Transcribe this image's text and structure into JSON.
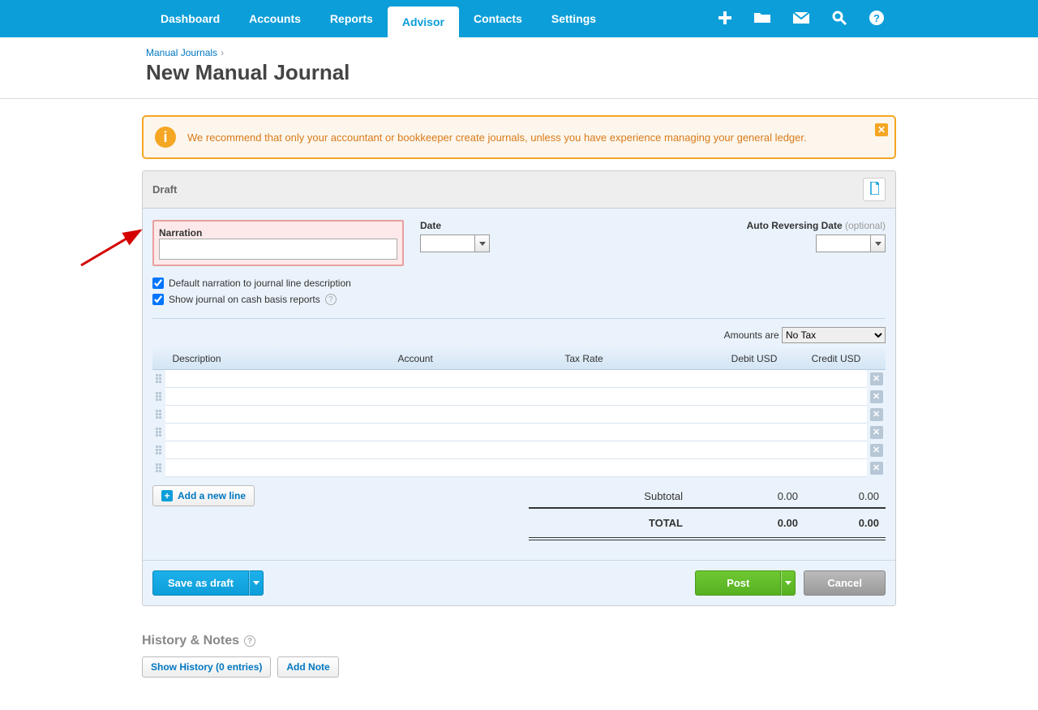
{
  "nav": {
    "tabs": [
      "Dashboard",
      "Accounts",
      "Reports",
      "Advisor",
      "Contacts",
      "Settings"
    ],
    "active_index": 3
  },
  "breadcrumb": {
    "link": "Manual Journals"
  },
  "page_title": "New Manual Journal",
  "alert": {
    "message": "We recommend that only your accountant or bookkeeper create journals, unless you have experience managing your general ledger."
  },
  "panel": {
    "status": "Draft",
    "labels": {
      "narration": "Narration",
      "date": "Date",
      "auto_reverse": "Auto Reversing Date",
      "optional": "(optional)",
      "default_narration": "Default narration to journal line description",
      "show_cash": "Show journal on cash basis reports",
      "amounts_are": "Amounts are",
      "add_line": "Add a new line",
      "subtotal": "Subtotal",
      "total": "TOTAL"
    },
    "tax_option": "No Tax",
    "columns": {
      "description": "Description",
      "account": "Account",
      "tax_rate": "Tax Rate",
      "debit": "Debit USD",
      "credit": "Credit USD"
    },
    "subtotal_debit": "0.00",
    "subtotal_credit": "0.00",
    "total_debit": "0.00",
    "total_credit": "0.00"
  },
  "buttons": {
    "save_draft": "Save as draft",
    "post": "Post",
    "cancel": "Cancel"
  },
  "history": {
    "title": "History & Notes",
    "show": "Show History (0 entries)",
    "add_note": "Add Note"
  }
}
